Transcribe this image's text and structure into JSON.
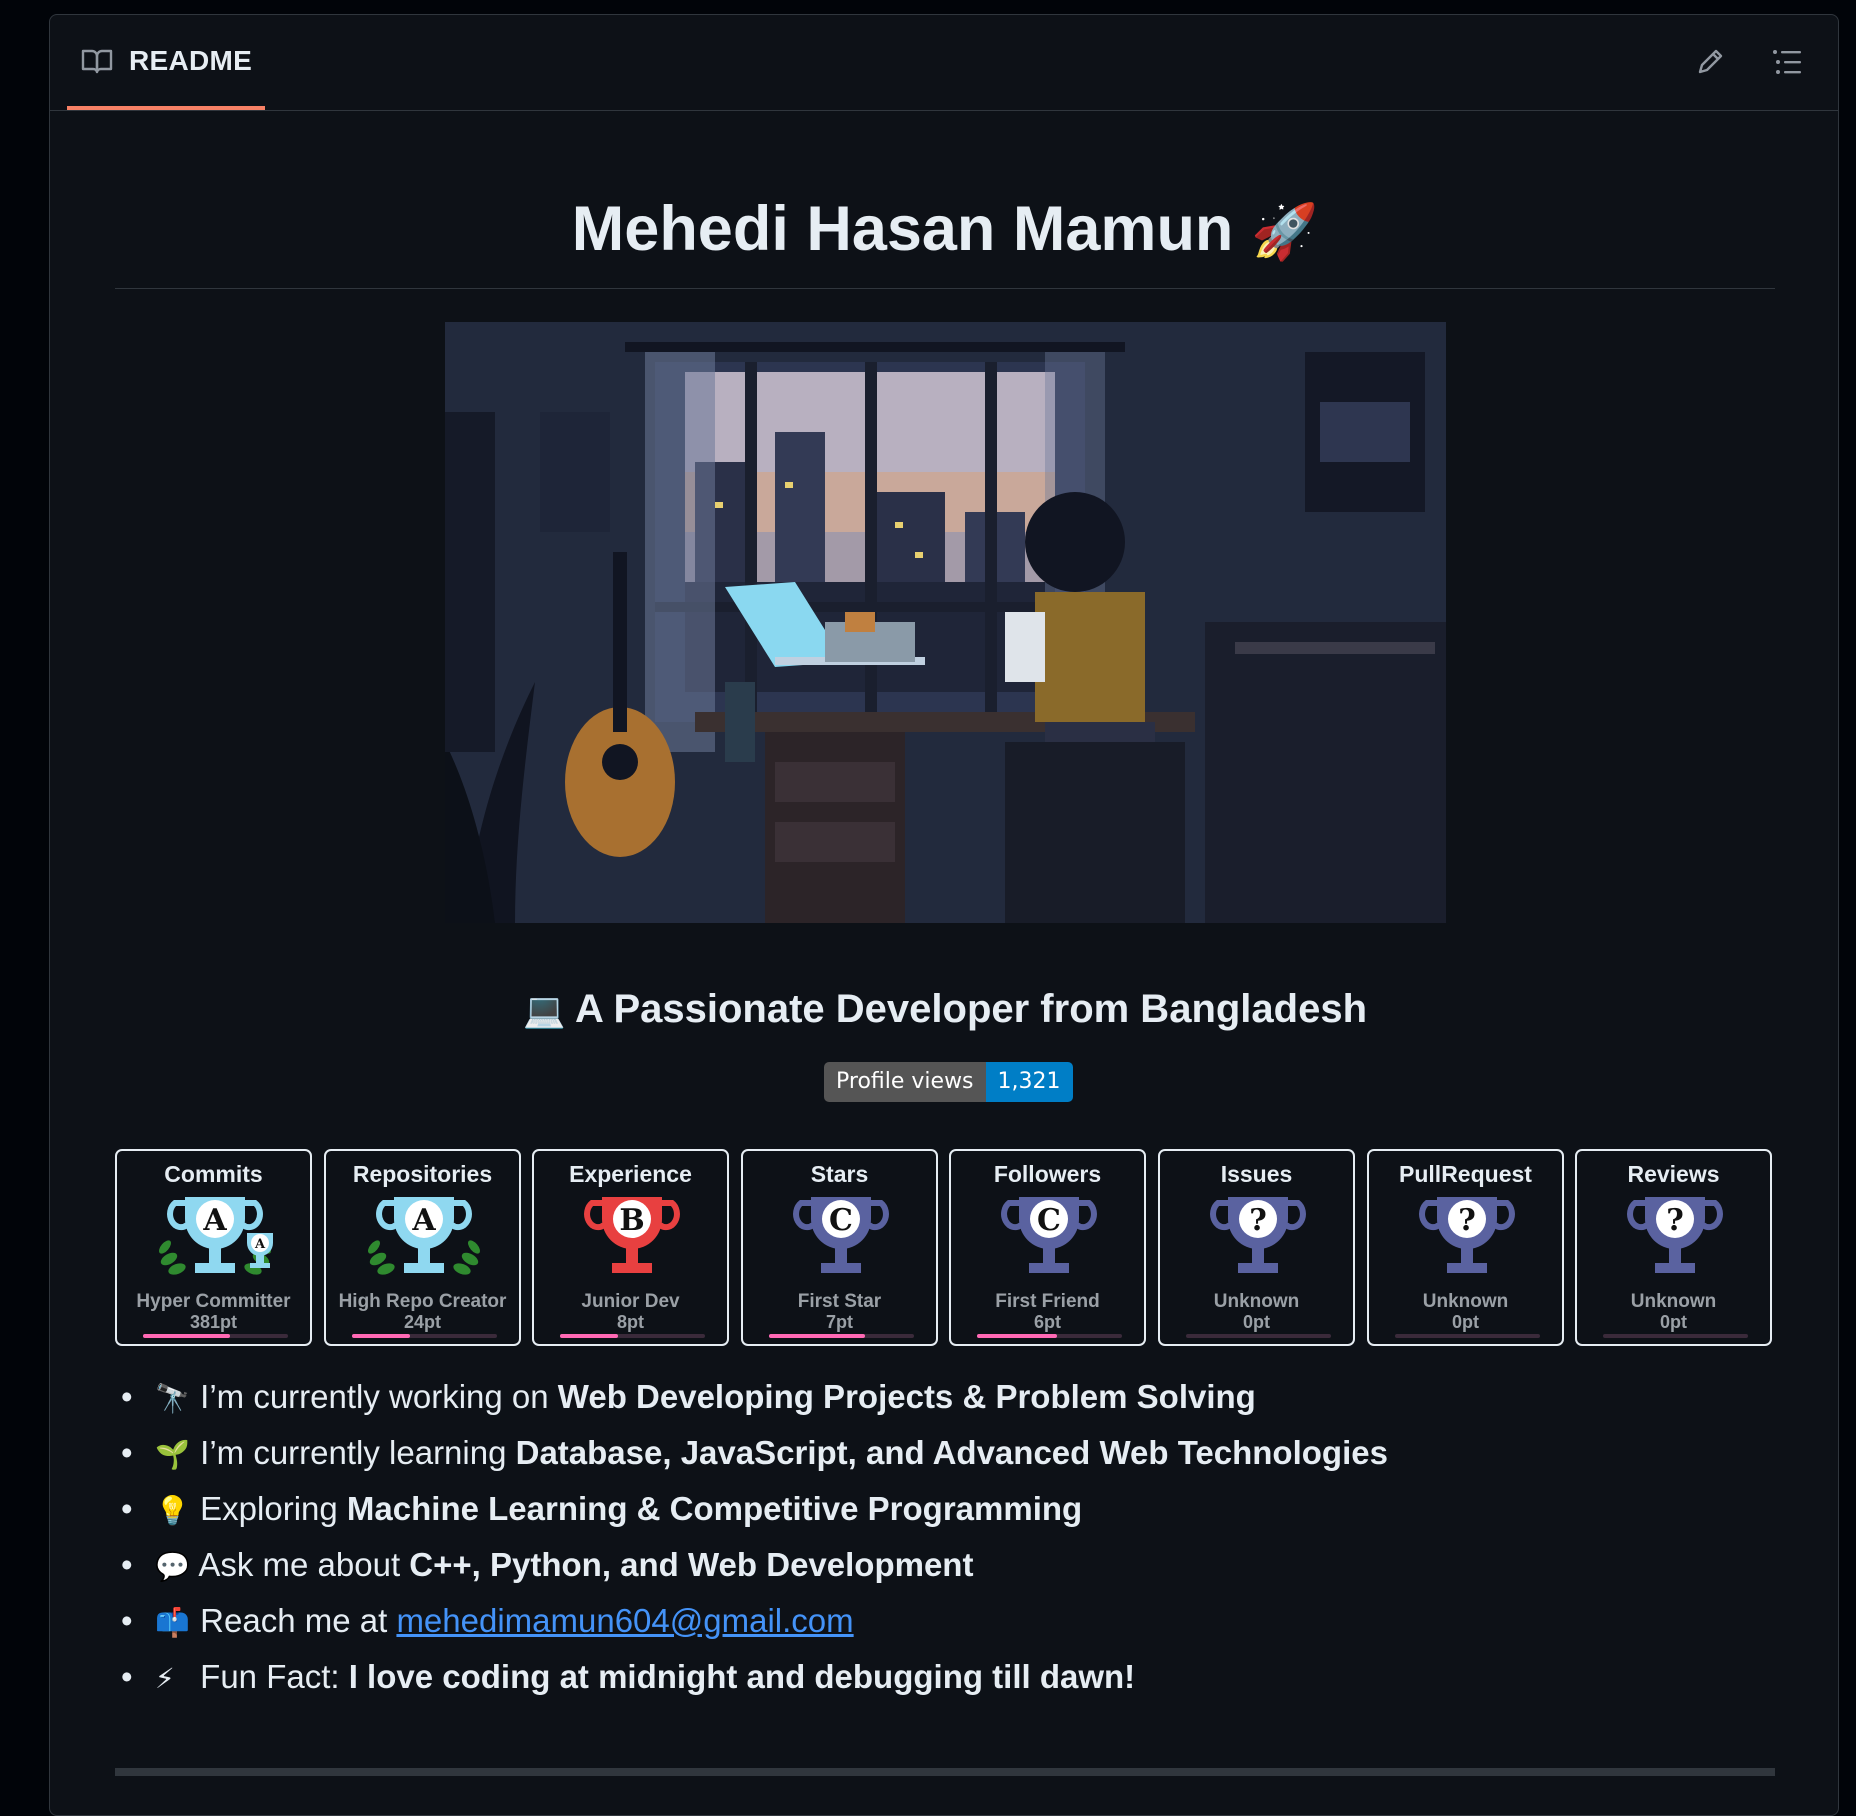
{
  "header": {
    "tab_label": "README",
    "icons": [
      "book-icon",
      "pencil-icon",
      "list-icon"
    ]
  },
  "readme": {
    "title": "Mehedi Hasan Mamun",
    "title_emoji": "🚀",
    "subtitle": "A Passionate Developer from Bangladesh",
    "subtitle_emoji": "💻",
    "views_badge": {
      "label": "Profile views",
      "value": "1,321"
    },
    "colors": {
      "accent_tab": "#f78166",
      "link": "#4493f8",
      "badge_value_bg": "#007ec6",
      "progress": "#ff69b4"
    },
    "trophies": [
      {
        "title": "Commits",
        "rank": "A",
        "rank_extra": "A",
        "name": "Hyper Committer",
        "points": "381pt",
        "progress": 0.6,
        "color": "#8fd8f0"
      },
      {
        "title": "Repositories",
        "rank": "A",
        "name": "High Repo Creator",
        "points": "24pt",
        "progress": 0.4,
        "color": "#8fd8f0"
      },
      {
        "title": "Experience",
        "rank": "B",
        "name": "Junior Dev",
        "points": "8pt",
        "progress": 0.4,
        "color": "#e84040"
      },
      {
        "title": "Stars",
        "rank": "C",
        "name": "First Star",
        "points": "7pt",
        "progress": 0.66,
        "color": "#5a62a0"
      },
      {
        "title": "Followers",
        "rank": "C",
        "name": "First Friend",
        "points": "6pt",
        "progress": 0.55,
        "color": "#5a62a0"
      },
      {
        "title": "Issues",
        "rank": "?",
        "name": "Unknown",
        "points": "0pt",
        "progress": 0,
        "color": "#5a62a0"
      },
      {
        "title": "PullRequest",
        "rank": "?",
        "name": "Unknown",
        "points": "0pt",
        "progress": 0,
        "color": "#5a62a0"
      },
      {
        "title": "Reviews",
        "rank": "?",
        "name": "Unknown",
        "points": "0pt",
        "progress": 0,
        "color": "#5a62a0"
      }
    ],
    "bullets": [
      {
        "emoji": "🔭",
        "text": "I’m currently working on ",
        "bold": "Web Developing Projects & Problem Solving"
      },
      {
        "emoji": "🌱",
        "text": "I’m currently learning ",
        "bold": "Database, JavaScript, and Advanced Web Technologies"
      },
      {
        "emoji": "💡",
        "text": "Exploring ",
        "bold": "Machine Learning & Competitive Programming"
      },
      {
        "emoji": "💬",
        "text": "Ask me about ",
        "bold": "C++, Python, and Web Development"
      },
      {
        "emoji": "📫",
        "text": "Reach me at ",
        "link": "mehedimamun604@gmail.com"
      },
      {
        "emoji": "⚡",
        "text": "Fun Fact: ",
        "bold": "I love coding at midnight and debugging till dawn!"
      }
    ]
  }
}
